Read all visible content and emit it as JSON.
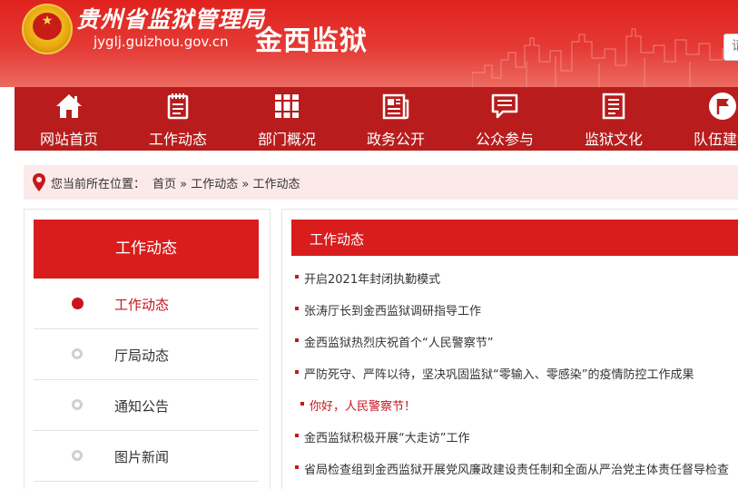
{
  "header": {
    "bureau_title": "贵州省监狱管理局",
    "site_url": "jyglj.guizhou.gov.cn",
    "prison_name": "金西监狱",
    "search_placeholder": "请"
  },
  "nav": {
    "items": [
      {
        "label": "网站首页",
        "icon": "home-icon"
      },
      {
        "label": "工作动态",
        "icon": "notepad-icon"
      },
      {
        "label": "部门概况",
        "icon": "binders-icon"
      },
      {
        "label": "政务公开",
        "icon": "newspaper-icon"
      },
      {
        "label": "公众参与",
        "icon": "message-icon"
      },
      {
        "label": "监狱文化",
        "icon": "document-icon"
      },
      {
        "label": "队伍建设",
        "icon": "flag-icon"
      }
    ]
  },
  "breadcrumb": {
    "prefix": "您当前所在位置：",
    "items": [
      "首页",
      "工作动态",
      "工作动态"
    ],
    "separator": "»"
  },
  "sidebar": {
    "title": "工作动态",
    "items": [
      {
        "label": "工作动态",
        "active": true
      },
      {
        "label": "厅局动态",
        "active": false
      },
      {
        "label": "通知公告",
        "active": false
      },
      {
        "label": "图片新闻",
        "active": false
      }
    ]
  },
  "main": {
    "title": "工作动态",
    "news": [
      {
        "title": "开启2021年封闭执勤模式"
      },
      {
        "title": "张涛厅长到金西监狱调研指导工作"
      },
      {
        "title": "金西监狱热烈庆祝首个“人民警察节”"
      },
      {
        "title": "严防死守、严阵以待，坚决巩固监狱“零输入、零感染”的疫情防控工作成果"
      },
      {
        "title": "你好，人民警察节！"
      },
      {
        "title": "金西监狱积极开展“大走访”工作"
      },
      {
        "title": "省局检查组到金西监狱开展党风廉政建设责任制和全面从严治党主体责任督导检查"
      }
    ]
  },
  "colors": {
    "header_red": "#e0221d",
    "nav_red": "#b81c1c",
    "accent_red": "#d91d1d",
    "active_text": "#c8161d",
    "breadcrumb_bg": "#fce9e9"
  }
}
